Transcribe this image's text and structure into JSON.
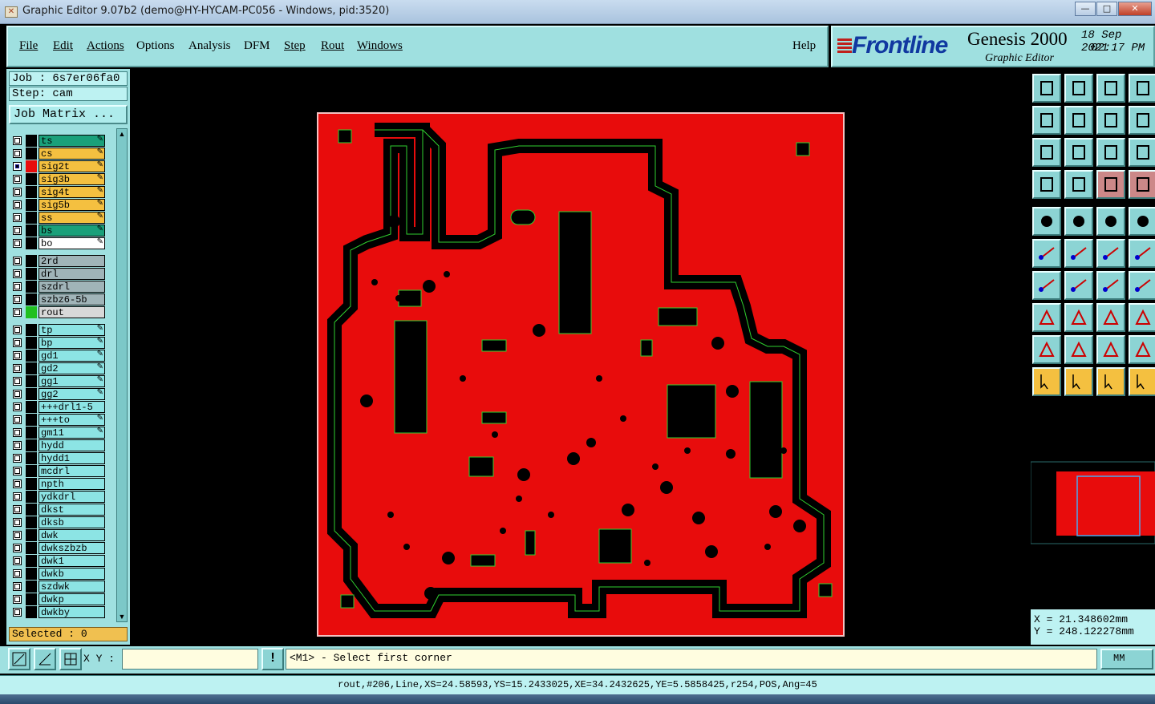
{
  "window": {
    "title": "Graphic Editor 9.07b2 (demo@HY-HYCAM-PC056 - Windows, pid:3520)",
    "icon": "app-icon"
  },
  "menu": [
    {
      "label": "File",
      "underline": true
    },
    {
      "label": "Edit",
      "underline": true
    },
    {
      "label": "Actions",
      "underline": true
    },
    {
      "label": "Options",
      "underline": false
    },
    {
      "label": "Analysis",
      "underline": false
    },
    {
      "label": "DFM",
      "underline": false
    },
    {
      "label": "Step",
      "underline": true
    },
    {
      "label": "Rout",
      "underline": true
    },
    {
      "label": "Windows",
      "underline": true
    },
    {
      "label": "Help",
      "underline": false
    }
  ],
  "brand": {
    "logo": "Frontline",
    "product": "Genesis 2000",
    "subtitle": "Graphic Editor",
    "date": "18 Sep 2021",
    "time": "02:17 PM"
  },
  "job": {
    "job_label": "Job : 6s7er06fa0",
    "step_label": "Step: cam",
    "matrix_button": "Job Matrix ..."
  },
  "layers": [
    {
      "name": "ts",
      "color": "#1aa07a",
      "editable": true
    },
    {
      "name": "cs",
      "color": "#f4c040",
      "editable": true
    },
    {
      "name": "sig2t",
      "color": "#f4c040",
      "editable": true,
      "active": true,
      "swatch": "#e80c0c"
    },
    {
      "name": "sig3b",
      "color": "#f4c040",
      "editable": true
    },
    {
      "name": "sig4t",
      "color": "#f4c040",
      "editable": true
    },
    {
      "name": "sig5b",
      "color": "#f4c040",
      "editable": true
    },
    {
      "name": "ss",
      "color": "#f4c040",
      "editable": true
    },
    {
      "name": "bs",
      "color": "#1aa07a",
      "editable": true
    },
    {
      "name": "bo",
      "color": "#ffffff",
      "editable": true
    },
    {
      "name": "2rd",
      "color": "#a0b4b8",
      "editable": false
    },
    {
      "name": "drl",
      "color": "#a0b4b8",
      "editable": false
    },
    {
      "name": "szdrl",
      "color": "#a0b4b8",
      "editable": false
    },
    {
      "name": "szbz6-5b",
      "color": "#a0b4b8",
      "editable": false
    },
    {
      "name": "rout",
      "color": "#d8d8d8",
      "editable": false,
      "swatch": "#20c020"
    },
    {
      "name": "tp",
      "color": "#8ce4e4",
      "editable": true
    },
    {
      "name": "bp",
      "color": "#8ce4e4",
      "editable": true
    },
    {
      "name": "gd1",
      "color": "#8ce4e4",
      "editable": true
    },
    {
      "name": "gd2",
      "color": "#8ce4e4",
      "editable": true
    },
    {
      "name": "gg1",
      "color": "#8ce4e4",
      "editable": true
    },
    {
      "name": "gg2",
      "color": "#8ce4e4",
      "editable": true
    },
    {
      "name": "+++drl1-5",
      "color": "#8ce4e4",
      "editable": false
    },
    {
      "name": "+++to",
      "color": "#8ce4e4",
      "editable": true
    },
    {
      "name": "gm11",
      "color": "#8ce4e4",
      "editable": true
    },
    {
      "name": "hydd",
      "color": "#8ce4e4",
      "editable": false
    },
    {
      "name": "hydd1",
      "color": "#8ce4e4",
      "editable": false
    },
    {
      "name": "mcdrl",
      "color": "#8ce4e4",
      "editable": false
    },
    {
      "name": "npth",
      "color": "#8ce4e4",
      "editable": false
    },
    {
      "name": "ydkdrl",
      "color": "#8ce4e4",
      "editable": false
    },
    {
      "name": "dkst",
      "color": "#8ce4e4",
      "editable": false
    },
    {
      "name": "dksb",
      "color": "#8ce4e4",
      "editable": false
    },
    {
      "name": "dwk",
      "color": "#8ce4e4",
      "editable": false
    },
    {
      "name": "dwkszbzb",
      "color": "#8ce4e4",
      "editable": false
    },
    {
      "name": "dwk1",
      "color": "#8ce4e4",
      "editable": false
    },
    {
      "name": "dwkb",
      "color": "#8ce4e4",
      "editable": false
    },
    {
      "name": "szdwk",
      "color": "#8ce4e4",
      "editable": false
    },
    {
      "name": "dwkp",
      "color": "#8ce4e4",
      "editable": false
    },
    {
      "name": "dwkby",
      "color": "#8ce4e4",
      "editable": false
    }
  ],
  "selected": "Selected : 0",
  "coords": {
    "x": "X = 21.348602mm",
    "y": "Y = 248.122278mm"
  },
  "input": {
    "xy_label": "X Y :",
    "xy_value": ""
  },
  "prompt": "<M1> - Select first corner",
  "units": "MM",
  "status": "rout,#206,Line,XS=24.58593,YS=15.2433025,XE=34.2432625,YE=5.5858425,r254,POS,Ang=45",
  "colors": {
    "panel": "#9fe0e0",
    "copper": "#e80c0c",
    "outline": "#2fd02f"
  }
}
